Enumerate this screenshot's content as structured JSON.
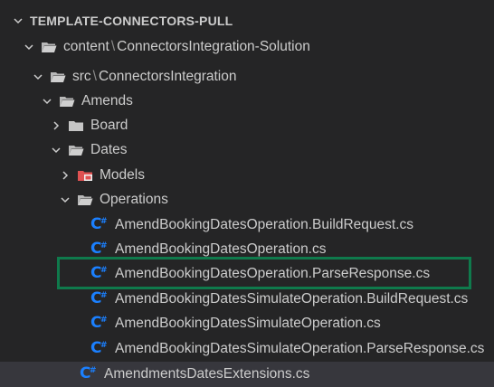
{
  "section": {
    "title": "TEMPLATE-CONNECTORS-PULL"
  },
  "tree": {
    "content_folder": {
      "name": "content",
      "sub": "ConnectorsIntegration-Solution"
    },
    "src_folder": {
      "name": "src",
      "sub": "ConnectorsIntegration"
    },
    "amends": "Amends",
    "board": "Board",
    "dates": "Dates",
    "models": "Models",
    "operations": "Operations",
    "files": [
      "AmendBookingDatesOperation.BuildRequest.cs",
      "AmendBookingDatesOperation.cs",
      "AmendBookingDatesOperation.ParseResponse.cs",
      "AmendBookingDatesSimulateOperation.BuildRequest.cs",
      "AmendBookingDatesSimulateOperation.cs",
      "AmendBookingDatesSimulateOperation.ParseResponse.cs"
    ],
    "extensions_file": "AmendmentsDatesExtensions.cs",
    "path_separator": "\\"
  },
  "colors": {
    "background": "#252526",
    "text": "#cccccc",
    "csharp_icon": "#1b80ff",
    "models_folder": "#e05252",
    "highlight_border": "#0f7a4c"
  },
  "icons": {
    "chevron_down": "chevron-down-icon",
    "chevron_right": "chevron-right-icon",
    "folder": "folder-icon",
    "folder_open": "folder-open-icon",
    "csharp": "csharp-file-icon"
  }
}
